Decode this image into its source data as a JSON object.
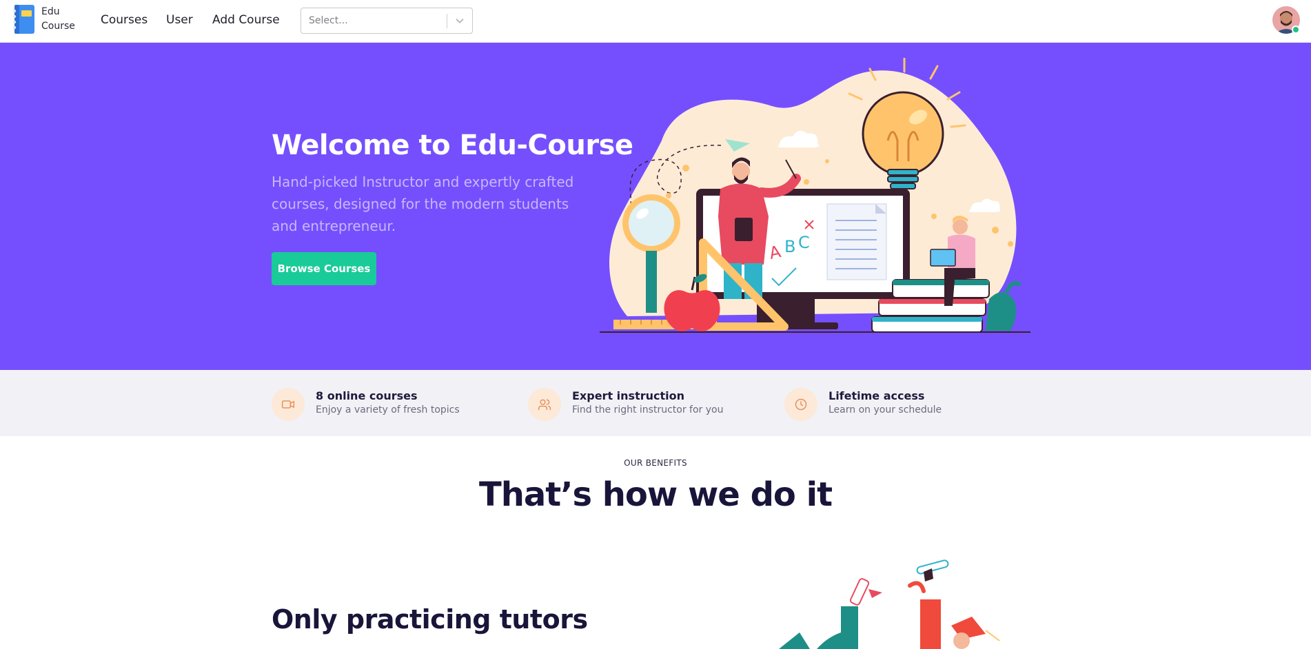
{
  "app": {
    "brand_line1": "Edu",
    "brand_line2": "Course"
  },
  "nav": {
    "links": [
      {
        "label": "Courses"
      },
      {
        "label": "User"
      },
      {
        "label": "Add Course"
      }
    ]
  },
  "search_select": {
    "placeholder": "Select..."
  },
  "user": {
    "status": "online"
  },
  "hero": {
    "title": "Welcome to Edu-Course",
    "subtitle": "Hand-picked Instructor and expertly crafted courses, designed for the modern students and entrepreneur.",
    "cta_label": "Browse Courses"
  },
  "features": [
    {
      "icon": "video-icon",
      "title": "8 online courses",
      "desc": "Enjoy a variety of fresh topics"
    },
    {
      "icon": "users-icon",
      "title": "Expert instruction",
      "desc": "Find the right instructor for you"
    },
    {
      "icon": "clock-icon",
      "title": "Lifetime access",
      "desc": "Learn on your schedule"
    }
  ],
  "benefits": {
    "eyebrow": "OUR BENEFITS",
    "title": "That’s how we do it",
    "first_item_title": "Only practicing tutors"
  },
  "colors": {
    "primary": "#754ffe",
    "cta": "#19cb98",
    "feature_icon_bg": "#fde9d8",
    "feature_icon_stroke": "#e8915c",
    "strip_bg": "#f2f1f6",
    "heading": "#19153a"
  }
}
